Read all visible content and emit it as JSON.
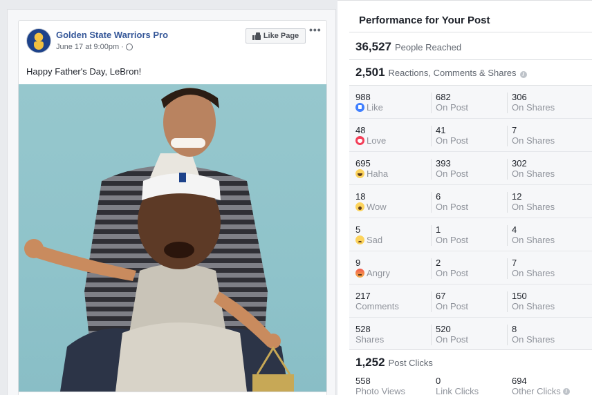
{
  "post": {
    "page_name": "Golden State Warriors Pro",
    "date": "June 17 at 9:00pm",
    "separator": "·",
    "like_page_label": "Like Page",
    "more_label": "•••",
    "text": "Happy Father's Day, LeBron!"
  },
  "performance": {
    "title": "Performance for Your Post",
    "people_reached": {
      "value": "36,527",
      "label": "People Reached"
    },
    "engagement": {
      "value": "2,501",
      "label": "Reactions, Comments & Shares"
    },
    "rows": [
      {
        "total": "988",
        "label": "Like",
        "icon": "like-icon",
        "on_post": "682",
        "on_post_label": "On Post",
        "on_shares": "306",
        "on_shares_label": "On Shares"
      },
      {
        "total": "48",
        "label": "Love",
        "icon": "love-icon",
        "on_post": "41",
        "on_post_label": "On Post",
        "on_shares": "7",
        "on_shares_label": "On Shares"
      },
      {
        "total": "695",
        "label": "Haha",
        "icon": "haha-icon",
        "on_post": "393",
        "on_post_label": "On Post",
        "on_shares": "302",
        "on_shares_label": "On Shares"
      },
      {
        "total": "18",
        "label": "Wow",
        "icon": "wow-icon",
        "on_post": "6",
        "on_post_label": "On Post",
        "on_shares": "12",
        "on_shares_label": "On Shares"
      },
      {
        "total": "5",
        "label": "Sad",
        "icon": "sad-icon",
        "on_post": "1",
        "on_post_label": "On Post",
        "on_shares": "4",
        "on_shares_label": "On Shares"
      },
      {
        "total": "9",
        "label": "Angry",
        "icon": "angry-icon",
        "on_post": "2",
        "on_post_label": "On Post",
        "on_shares": "7",
        "on_shares_label": "On Shares"
      },
      {
        "total": "217",
        "label": "Comments",
        "on_post": "67",
        "on_post_label": "On Post",
        "on_shares": "150",
        "on_shares_label": "On Shares"
      },
      {
        "total": "528",
        "label": "Shares",
        "on_post": "520",
        "on_post_label": "On Post",
        "on_shares": "8",
        "on_shares_label": "On Shares"
      }
    ],
    "post_clicks": {
      "value": "1,252",
      "label": "Post Clicks"
    },
    "clicks": [
      {
        "value": "558",
        "label": "Photo Views"
      },
      {
        "value": "0",
        "label": "Link Clicks"
      },
      {
        "value": "694",
        "label": "Other Clicks"
      }
    ]
  },
  "colors": {
    "link_blue": "#365899",
    "muted_text": "#616770",
    "panel_bg": "#f6f7f9",
    "page_bg": "#e9ebee"
  }
}
